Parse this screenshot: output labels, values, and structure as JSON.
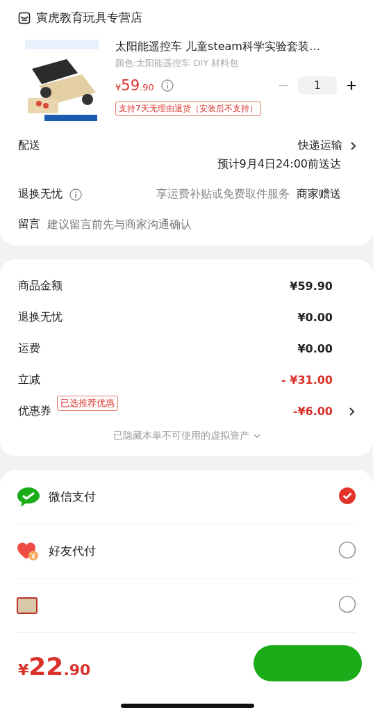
{
  "store": {
    "name": "寅虎教育玩具专营店"
  },
  "product": {
    "title": "太阳能遥控车 儿童steam科学实验套装…",
    "variant": "颜色:太阳能遥控车 DIY 材料包",
    "currency": "¥",
    "price_main": "59",
    "price_decimal": ".90",
    "quantity": "1",
    "return_tag": "支持7天无理由退货（安装后不支持）"
  },
  "delivery": {
    "label": "配送",
    "method": "快递运输",
    "eta": "预计9月4日24:00前送达"
  },
  "returns": {
    "label": "退换无忧",
    "description": "享运费补贴或免费取件服务",
    "value": "商家赠送"
  },
  "message": {
    "label": "留言",
    "placeholder": "建议留言前先与商家沟通确认"
  },
  "summary": [
    {
      "label": "商品金额",
      "value": "¥59.90",
      "kind": "normal"
    },
    {
      "label": "退换无忧",
      "value": "¥0.00",
      "kind": "normal"
    },
    {
      "label": "运费",
      "value": "¥0.00",
      "kind": "normal"
    },
    {
      "label": "立减",
      "value": "- ¥31.00",
      "kind": "discount"
    },
    {
      "label": "优惠券",
      "tag": "已选推荐优惠",
      "value": "-¥6.00",
      "kind": "discount",
      "arrow": true
    }
  ],
  "hidden_assets": "已隐藏本单不可使用的虚拟资产",
  "payments": [
    {
      "kind": "wechat",
      "name": "微信支付",
      "selected": true
    },
    {
      "kind": "friend",
      "name": "好友代付",
      "selected": false
    },
    {
      "kind": "card",
      "selected": false
    }
  ],
  "total": {
    "currency": "¥",
    "main": "22",
    "decimal": ".90"
  }
}
